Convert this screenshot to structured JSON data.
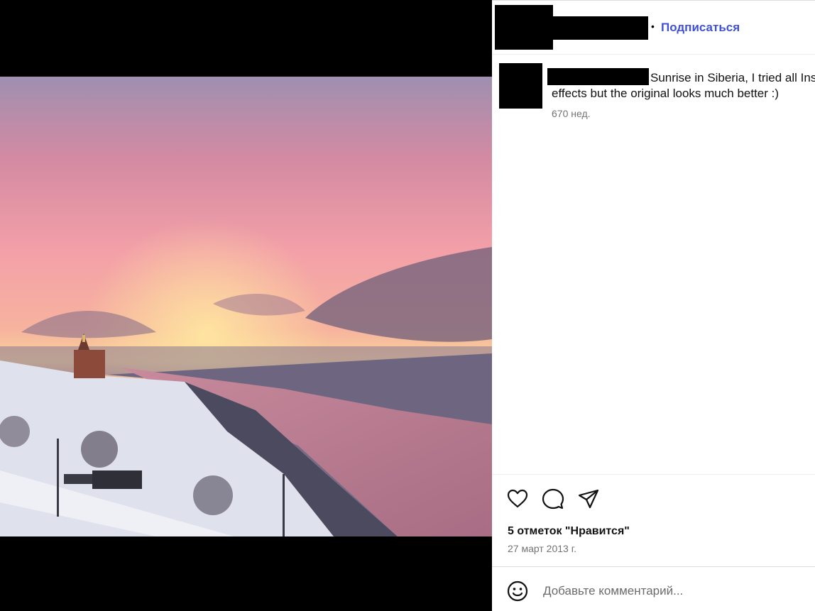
{
  "post": {
    "follow_label": "Подписаться",
    "separator": "•",
    "caption_line1": "Sunrise in Siberia, I tried all Ins",
    "caption_line2": "effects but the original looks much better :)",
    "caption_time": "670 нед.",
    "likes_text": "5 отметок \"Нравится\"",
    "date_text": "27 март 2013 г."
  },
  "comment": {
    "placeholder": "Добавьте комментарий..."
  },
  "icons": {
    "like": "heart-icon",
    "comment": "comment-icon",
    "share": "share-icon",
    "emoji": "emoji-icon"
  },
  "colors": {
    "follow": "#4051d6",
    "secondary_text": "#737373"
  }
}
